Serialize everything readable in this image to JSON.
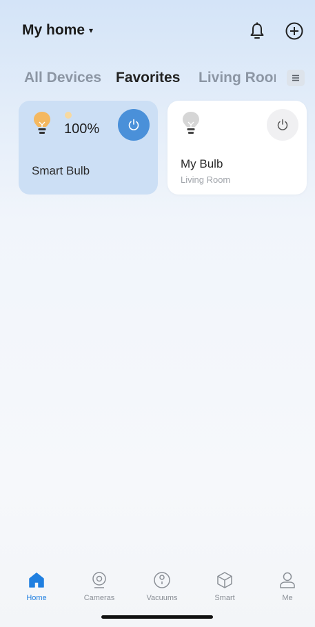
{
  "header": {
    "home_title": "My home",
    "caret": "▾"
  },
  "tabs": [
    {
      "label": "All Devices",
      "active": false
    },
    {
      "label": "Favorites",
      "active": true
    },
    {
      "label": "Living Room",
      "active": false
    }
  ],
  "devices": [
    {
      "name": "Smart Bulb",
      "brightness": "100%",
      "on": true,
      "room": ""
    },
    {
      "name": "My Bulb",
      "room": "Living Room",
      "on": false
    }
  ],
  "bottom_nav": [
    {
      "label": "Home",
      "active": true
    },
    {
      "label": "Cameras",
      "active": false
    },
    {
      "label": "Vacuums",
      "active": false
    },
    {
      "label": "Smart",
      "active": false
    },
    {
      "label": "Me",
      "active": false
    }
  ],
  "colors": {
    "accent": "#1f7fe0",
    "power_on": "#4a90d9",
    "bulb_on": "#f4b860",
    "bulb_off": "#c9c9c9",
    "card_active_bg": "#ccdff5"
  },
  "icons": {
    "bell": "bell-icon",
    "add": "add-circle-icon",
    "menu": "menu-icon",
    "bulb": "bulb-icon",
    "power": "power-icon",
    "home": "home-icon",
    "camera": "camera-icon",
    "vacuum": "vacuum-icon",
    "smart": "cube-icon",
    "me": "person-icon"
  }
}
